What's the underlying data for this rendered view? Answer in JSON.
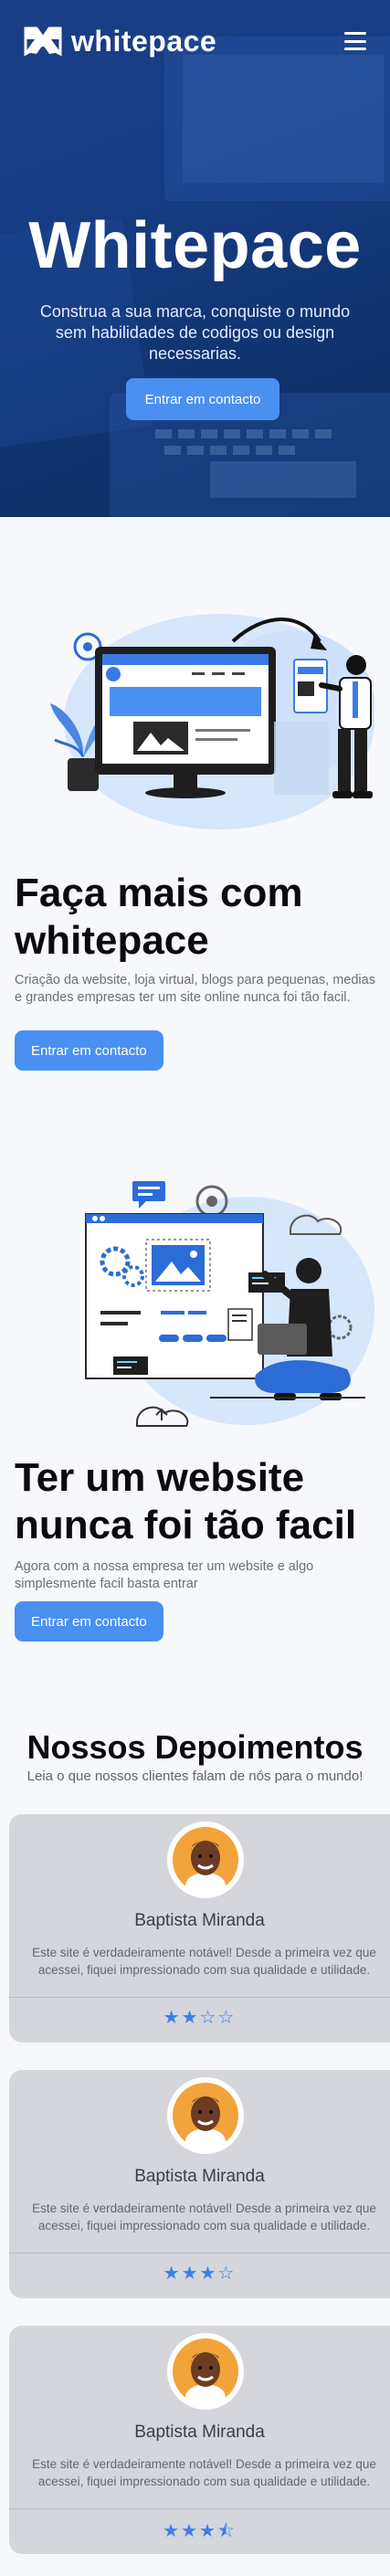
{
  "header": {
    "brand_name": "whitepace",
    "logo_icon": "whitepace-logo-icon",
    "menu_icon": "hamburger-menu-icon"
  },
  "hero": {
    "title": "Whitepace",
    "subtitle": "Construa a sua marca, conquiste o mundo sem habilidades de codigos ou design necessarias.",
    "cta_label": "Entrar em contacto"
  },
  "section1": {
    "title": "Faça mais com whitepace",
    "text": "Criação da website, loja virtual, blogs para pequenas, medias e grandes empresas ter um site online nunca foi tão facil.",
    "cta_label": "Entrar em contacto"
  },
  "section2": {
    "title": "Ter um website nunca foi tão facil",
    "text": "Agora com a nossa empresa ter um website e algo simplesmente facil basta entrar",
    "cta_label": "Entrar em contacto"
  },
  "testimonials": {
    "title": "Nossos Depoimentos",
    "subtitle": "Leia o que nossos clientes falam de nós para o mundo!",
    "items": [
      {
        "name": "Baptista Miranda",
        "quote": "Este site é verdadeiramente notável! Desde a primeira vez que acessei, fiquei impressionado com sua qualidade e utilidade.",
        "rating": 2,
        "stars": "★★☆☆"
      },
      {
        "name": "Baptista Miranda",
        "quote": "Este site é verdadeiramente notável! Desde a primeira vez que acessei, fiquei impressionado com sua qualidade e utilidade.",
        "rating": 3,
        "stars": "★★★☆"
      },
      {
        "name": "Baptista Miranda",
        "quote": "Este site é verdadeiramente notável! Desde a primeira vez que acessei, fiquei impressionado com sua qualidade e utilidade.",
        "rating": 3.5,
        "stars": "★★★⯪"
      }
    ]
  },
  "colors": {
    "hero_bg": "#173c83",
    "accent_blue": "#4a90f0",
    "card_bg": "#d4d6db",
    "star_blue": "#3d7ee8"
  }
}
